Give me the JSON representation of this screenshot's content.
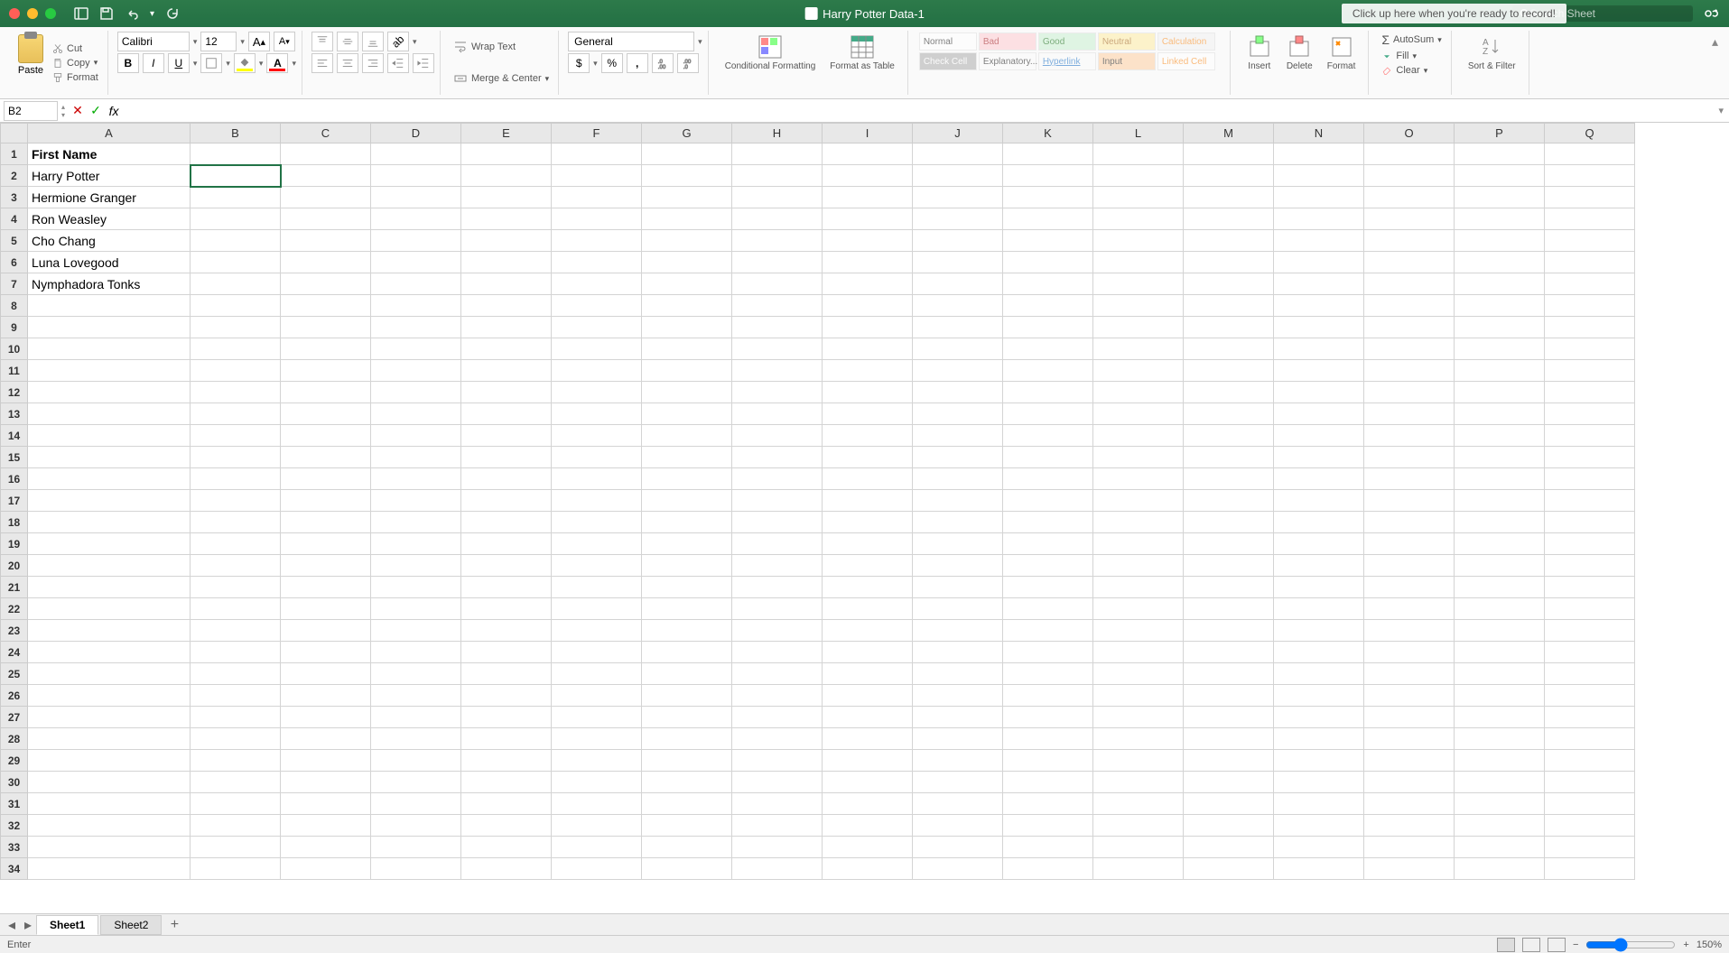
{
  "titlebar": {
    "title": "Harry Potter Data-1",
    "record_banner": "Click up here when you're ready to record!",
    "search_placeholder": "Search Sheet"
  },
  "ribbon": {
    "paste": "Paste",
    "cut": "Cut",
    "copy": "Copy",
    "format_painter": "Format",
    "font_name": "Calibri",
    "font_size": "12",
    "wrap_text": "Wrap Text",
    "merge_center": "Merge & Center",
    "number_format": "General",
    "cond_format": "Conditional Formatting",
    "format_table": "Format as Table",
    "styles": {
      "normal": "Normal",
      "bad": "Bad",
      "good": "Good",
      "neutral": "Neutral",
      "calculation": "Calculation",
      "check_cell": "Check Cell",
      "explanatory": "Explanatory...",
      "hyperlink": "Hyperlink",
      "input": "Input",
      "linked_cell": "Linked Cell"
    },
    "insert": "Insert",
    "delete": "Delete",
    "format_btn": "Format",
    "autosum": "AutoSum",
    "fill": "Fill",
    "clear": "Clear",
    "sort_filter": "Sort & Filter"
  },
  "formula_bar": {
    "cell_ref": "B2",
    "formula": ""
  },
  "columns": [
    "A",
    "B",
    "C",
    "D",
    "E",
    "F",
    "G",
    "H",
    "I",
    "J",
    "K",
    "L",
    "M",
    "N",
    "O",
    "P",
    "Q"
  ],
  "row_count": 34,
  "cells": {
    "A1": {
      "value": "First Name",
      "bold": true
    },
    "A2": {
      "value": "Harry Potter"
    },
    "A3": {
      "value": "Hermione Granger"
    },
    "A4": {
      "value": "Ron Weasley"
    },
    "A5": {
      "value": "Cho Chang"
    },
    "A6": {
      "value": "Luna Lovegood"
    },
    "A7": {
      "value": "Nymphadora Tonks"
    }
  },
  "selected_cell": "B2",
  "sheets": {
    "tabs": [
      "Sheet1",
      "Sheet2"
    ],
    "active": 0
  },
  "status": {
    "mode": "Enter",
    "zoom": "150%"
  }
}
